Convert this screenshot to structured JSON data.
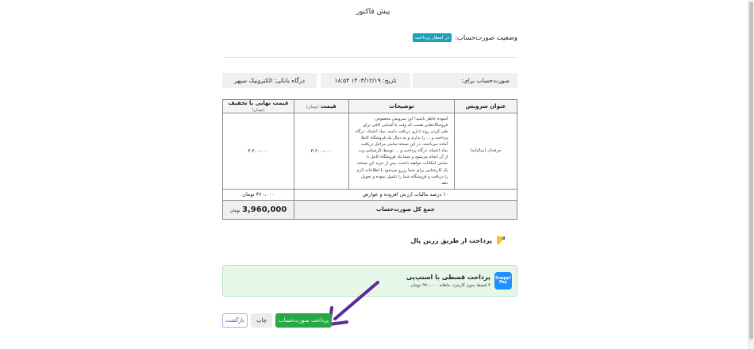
{
  "header": {
    "title": "پیش فاکتور"
  },
  "status": {
    "label": "وضعیت صورت‌حساب:",
    "badge": "در انتظار پرداخت",
    "badge_color": "#17a2b8"
  },
  "info": {
    "recipient_label": "صورت‌حساب برای:",
    "date_label": "تاریخ:",
    "date_value": "۱۴۰۳/۱۲/۱۹ ۱۸:۵۴",
    "gateway_label": "درگاه بانکی:",
    "gateway_value": "الکترونیک سپهر"
  },
  "table": {
    "headers": {
      "service": "عنوان سرویس",
      "description": "توضیحات",
      "price": "قیمت",
      "price_unit": "(تومان)",
      "final": "قیمت نهایی با تخفیف",
      "final_unit": "(تومان)"
    },
    "rows": [
      {
        "service": "حرفه‌ای (سالیانه)",
        "description": "آسوده خاطر باشید! این سرویس مخصوص فروشگاه‌هایی هست که وقت یا آشنایی کافی برای طی کردن روند اداری دریافت دامنه، نماد اعتماد، درگاه پرداخت و ... را ندارند و به دنبال یک فروشگاه کاملا آماده می‌باشند. در این نسخه تمامی مراحل دریافت نماد اعتماد، درگاه پرداخت و ... توسط کارشناس وب از آن انجام می‌شود و شما یک فروشگاه کامل با تمامی امکانات خواهید داشت. پس از خرید این نسخه، یک کارشناس برای شما رزرو می‌شود تا اطلاعات لازم را دریافت و فروشگاه شما را تکمیل نموده و تحویل دهد.",
        "price": "۳،۶۰۰،۰۰۰",
        "final": "۳،۶۰۰،۰۰۰"
      }
    ],
    "tax": {
      "label": "۱۰ درصد مالیات ارزش افزوده و عوارض",
      "value": "۳۶۰،۰۰۰ تومان"
    },
    "total": {
      "label": "جمع کل صورت‌حساب",
      "value": "3,960,000",
      "unit": "تومان"
    }
  },
  "zarinpal": {
    "label": "پرداخت از طریق زرین پال",
    "color": "#f5c518"
  },
  "snapp": {
    "logo": "Snapp! Pay",
    "title": "پرداخت قسطی با اسنپ‌پی",
    "subtitle": "۴ قسط بدون کارمزد، ماهانه ۹۹۰،۰۰۰ تومان",
    "color": "#1e90ff"
  },
  "actions": {
    "pay": "پرداخت صورت‌حساب",
    "print": "چاپ",
    "back": "بازگشت"
  },
  "colors": {
    "accent": "#28a745",
    "arrow": "#5b2a9b"
  }
}
